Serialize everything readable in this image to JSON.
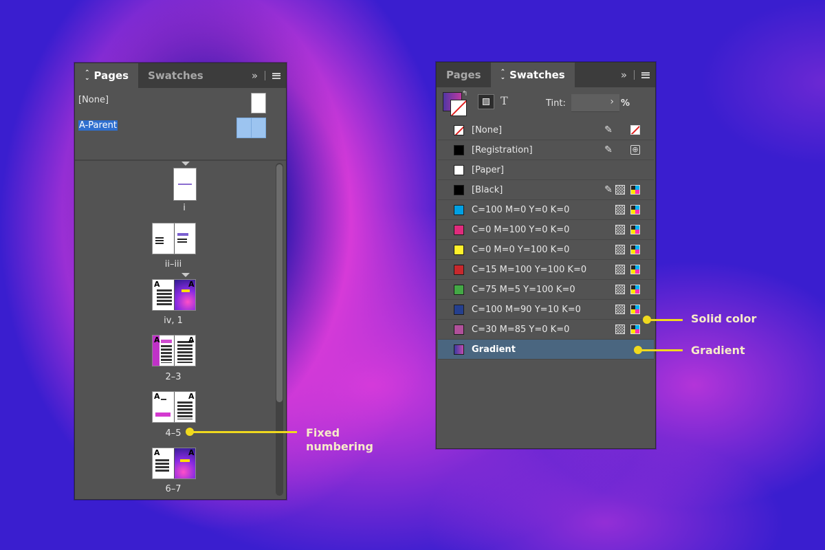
{
  "pages_panel": {
    "tabs": [
      {
        "label": "Pages",
        "active": true
      },
      {
        "label": "Swatches",
        "active": false
      }
    ],
    "parents": [
      {
        "label": "[None]",
        "selected": false
      },
      {
        "label": "A-Parent",
        "selected": true
      }
    ],
    "page_groups": [
      {
        "label": "i",
        "prefix": ""
      },
      {
        "label": "ii–iii",
        "prefix": ""
      },
      {
        "label": "iv, 1",
        "prefix": "A"
      },
      {
        "label": "2–3",
        "prefix": "A"
      },
      {
        "label": "4–5",
        "prefix": "A"
      },
      {
        "label": "6–7",
        "prefix": "A"
      }
    ]
  },
  "swatches_panel": {
    "tabs": [
      {
        "label": "Pages",
        "active": false
      },
      {
        "label": "Swatches",
        "active": true
      }
    ],
    "tint_label": "Tint:",
    "tint_value": "",
    "tint_unit": "%",
    "swatches": [
      {
        "name": "[None]",
        "color": "none"
      },
      {
        "name": "[Registration]",
        "color": "#000000"
      },
      {
        "name": "[Paper]",
        "color": "#ffffff"
      },
      {
        "name": "[Black]",
        "color": "#000000"
      },
      {
        "name": "C=100 M=0 Y=0 K=0",
        "color": "#00a0e3"
      },
      {
        "name": "C=0 M=100 Y=0 K=0",
        "color": "#e02b7c"
      },
      {
        "name": "C=0 M=0 Y=100 K=0",
        "color": "#fff02a"
      },
      {
        "name": "C=15 M=100 Y=100 K=0",
        "color": "#c8282d"
      },
      {
        "name": "C=75 M=5 Y=100 K=0",
        "color": "#43a845"
      },
      {
        "name": "C=100 M=90 Y=10 K=0",
        "color": "#253f8e"
      },
      {
        "name": "C=30 M=85 Y=0 K=0",
        "color": "#b0509a"
      },
      {
        "name": "Gradient",
        "color": "gradient",
        "selected": true
      }
    ]
  },
  "callouts": {
    "fixed_numbering": "Fixed\nnumbering",
    "solid_color": "Solid color",
    "gradient": "Gradient"
  },
  "colors": {
    "callout": "#f0d91e",
    "panel_bg": "#535353",
    "selection": "#4a6680"
  }
}
